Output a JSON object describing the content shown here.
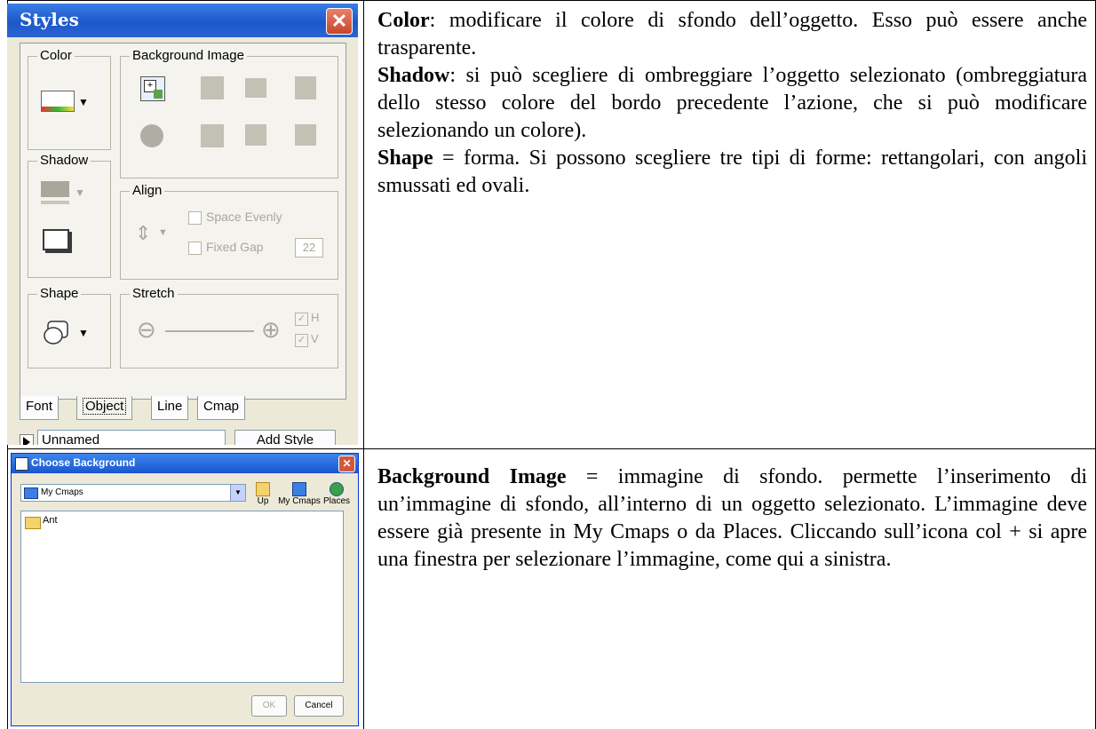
{
  "cell1": {
    "p1_term": "Color",
    "p1_text": ": modificare il colore di sfondo dell’oggetto. Esso può essere anche trasparente.",
    "p2_term": "Shadow",
    "p2_text": ": si può scegliere di ombreggiare l’oggetto selezionato (ombreggiatura dello stesso colore del bordo precedente l’azione, che si può modificare selezionando un colore).",
    "p3_term": "Shape",
    "p3_text": " = forma. Si possono scegliere tre tipi di forme: rettangolari, con angoli smussati ed ovali."
  },
  "cell2": {
    "p1_term": "Background Image",
    "p1_text": " = immagine di sfondo. permette l’inserimento di un’immagine di sfondo, all’interno di un oggetto selezionato. L’immagine deve essere già presente in My Cmaps o da Places. Cliccando sull’icona col + si apre una finestra per selezionare l’immagine, come qui a sinistra."
  },
  "styles_panel": {
    "title": "Styles",
    "close": "✕",
    "groups": {
      "color": "Color",
      "background_image": "Background Image",
      "shadow": "Shadow",
      "align": "Align",
      "shape": "Shape",
      "stretch": "Stretch"
    },
    "space_evenly": "Space Evenly",
    "fixed_gap": "Fixed Gap",
    "fixed_gap_value": "22",
    "stretch_h": "H",
    "stretch_v": "V",
    "tabs": [
      "Font",
      "Object",
      "Line",
      "Cmap"
    ],
    "style_name_value": "Unnamed",
    "add_style": "Add Style"
  },
  "choose_background": {
    "title": "Choose Background",
    "close": "✕",
    "location": "My Cmaps",
    "toolbar": [
      "Up",
      "My Cmaps",
      "Places"
    ],
    "items": [
      "Ant"
    ],
    "ok": "OK",
    "cancel": "Cancel"
  }
}
